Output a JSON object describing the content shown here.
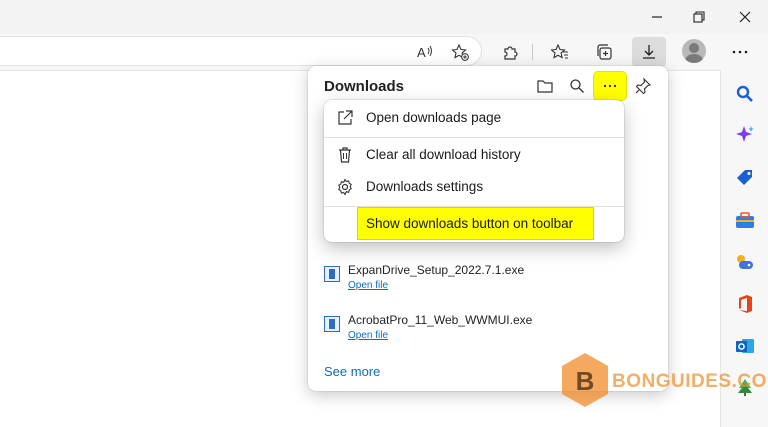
{
  "window_controls": {
    "minimize": "minimize",
    "restore": "restore",
    "close": "close"
  },
  "toolbar": {
    "icons": [
      "read-aloud-icon",
      "add-favorite-icon",
      "extensions-icon",
      "favorites-icon",
      "collections-icon",
      "downloads-icon",
      "profile-avatar",
      "more-icon"
    ]
  },
  "downloads": {
    "title": "Downloads",
    "items": [
      {
        "name": "ExpanDrive_Setup_2022.7.1.exe",
        "action": "Open file"
      },
      {
        "name": "AcrobatPro_11_Web_WWMUI.exe",
        "action": "Open file"
      }
    ],
    "see_more": "See more"
  },
  "menu": {
    "items": [
      {
        "label": "Open downloads page",
        "icon": "open-external-icon"
      },
      {
        "label": "Clear all download history",
        "icon": "trash-icon"
      },
      {
        "label": "Downloads settings",
        "icon": "gear-icon"
      },
      {
        "label": "Show downloads button on toolbar",
        "icon": "none"
      }
    ]
  },
  "sidebar": {
    "icons": [
      "search-icon",
      "sparkle-icon",
      "shopping-tag-icon",
      "tools-icon",
      "games-icon",
      "office-icon",
      "outlook-icon",
      "tree-icon"
    ]
  },
  "watermark": {
    "text": "BONGUIDES.COM",
    "letter": "B"
  },
  "colors": {
    "highlight": "#ffff00",
    "link": "#0f6cbd",
    "watermark": "#f08c28"
  }
}
